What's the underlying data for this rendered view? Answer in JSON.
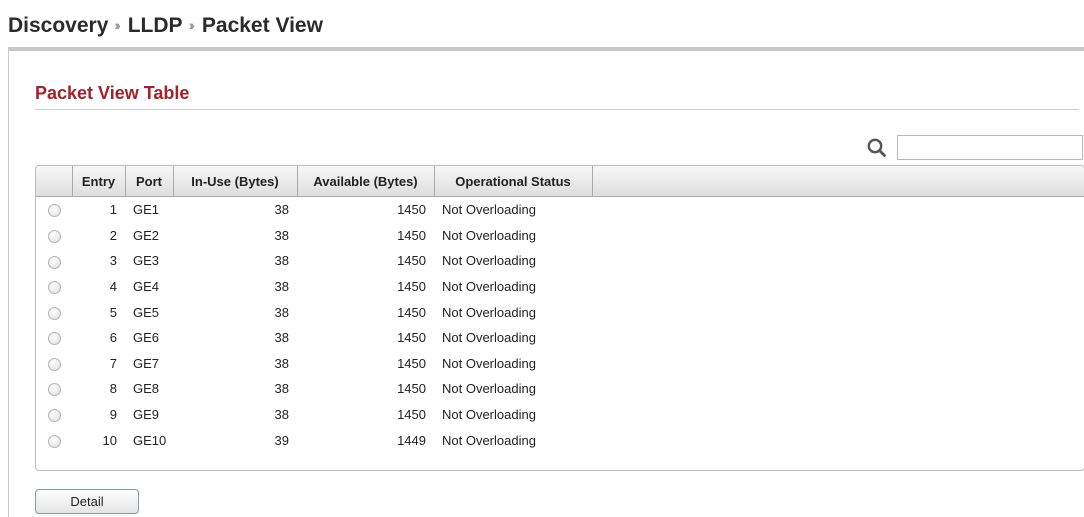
{
  "breadcrumb": {
    "items": [
      "Discovery",
      "LLDP",
      "Packet View"
    ],
    "separator": "››"
  },
  "section": {
    "title": "Packet View Table"
  },
  "search": {
    "value": "",
    "placeholder": ""
  },
  "table": {
    "headers": {
      "select": "",
      "entry": "Entry",
      "port": "Port",
      "in_use": "In-Use (Bytes)",
      "available": "Available (Bytes)",
      "status": "Operational Status"
    },
    "rows": [
      {
        "entry": "1",
        "port": "GE1",
        "in_use": "38",
        "available": "1450",
        "status": "Not Overloading"
      },
      {
        "entry": "2",
        "port": "GE2",
        "in_use": "38",
        "available": "1450",
        "status": "Not Overloading"
      },
      {
        "entry": "3",
        "port": "GE3",
        "in_use": "38",
        "available": "1450",
        "status": "Not Overloading"
      },
      {
        "entry": "4",
        "port": "GE4",
        "in_use": "38",
        "available": "1450",
        "status": "Not Overloading"
      },
      {
        "entry": "5",
        "port": "GE5",
        "in_use": "38",
        "available": "1450",
        "status": "Not Overloading"
      },
      {
        "entry": "6",
        "port": "GE6",
        "in_use": "38",
        "available": "1450",
        "status": "Not Overloading"
      },
      {
        "entry": "7",
        "port": "GE7",
        "in_use": "38",
        "available": "1450",
        "status": "Not Overloading"
      },
      {
        "entry": "8",
        "port": "GE8",
        "in_use": "38",
        "available": "1450",
        "status": "Not Overloading"
      },
      {
        "entry": "9",
        "port": "GE9",
        "in_use": "38",
        "available": "1450",
        "status": "Not Overloading"
      },
      {
        "entry": "10",
        "port": "GE10",
        "in_use": "39",
        "available": "1449",
        "status": "Not Overloading"
      }
    ]
  },
  "actions": {
    "detail_label": "Detail"
  },
  "icons": {
    "search": "search-icon",
    "row_select": "radio-button-icon"
  },
  "colors": {
    "section_title": "#a3222a",
    "header_bg_top": "#f7f7f7",
    "header_bg_bottom": "#dedede",
    "panel_rule": "#c9c9c9"
  }
}
